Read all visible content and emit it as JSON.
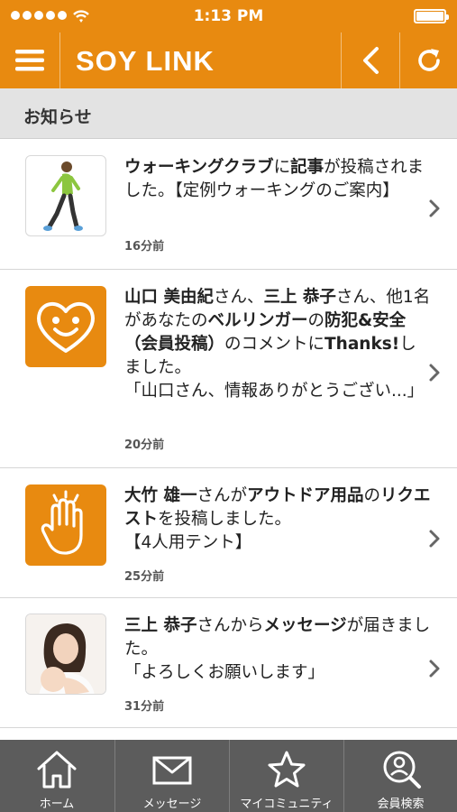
{
  "status_bar": {
    "time": "1:13 PM"
  },
  "header": {
    "logo": "SOY LINK"
  },
  "section": {
    "title": "お知らせ"
  },
  "notifications": [
    {
      "thumbnail": "walking-person-photo",
      "parts": [
        {
          "t": "ウォーキングクラブ",
          "b": true
        },
        {
          "t": "に",
          "b": false
        },
        {
          "t": "記事",
          "b": true
        },
        {
          "t": "が投稿されました。【定例ウォーキングのご案内】",
          "b": false
        }
      ],
      "time": "16分前"
    },
    {
      "thumbnail": "heart-face-icon",
      "parts": [
        {
          "t": "山口 美由紀",
          "b": true
        },
        {
          "t": "さん、",
          "b": false
        },
        {
          "t": "三上 恭子",
          "b": true
        },
        {
          "t": "さん、他1名があなたの",
          "b": false
        },
        {
          "t": "ベルリンガー",
          "b": true
        },
        {
          "t": "の",
          "b": false
        },
        {
          "t": "防犯&安全（会員投稿）",
          "b": true
        },
        {
          "t": "のコメントに",
          "b": false
        },
        {
          "t": "Thanks!",
          "b": true
        },
        {
          "t": "しました。\n「山口さん、情報ありがとうござい...」",
          "b": false
        }
      ],
      "time": "20分前"
    },
    {
      "thumbnail": "raised-hand-icon",
      "parts": [
        {
          "t": "大竹 雄一",
          "b": true
        },
        {
          "t": "さんが",
          "b": false
        },
        {
          "t": "アウトドア用品",
          "b": true
        },
        {
          "t": "の",
          "b": false
        },
        {
          "t": "リクエスト",
          "b": true
        },
        {
          "t": "を投稿しました。\n【4人用テント】",
          "b": false
        }
      ],
      "time": "25分前"
    },
    {
      "thumbnail": "mother-baby-photo",
      "parts": [
        {
          "t": "三上 恭子",
          "b": true
        },
        {
          "t": "さんから",
          "b": false
        },
        {
          "t": "メッセージ",
          "b": true
        },
        {
          "t": "が届きました。\n「よろしくお願いします」",
          "b": false
        }
      ],
      "time": "31分前"
    }
  ],
  "tabs": [
    {
      "label": "ホーム",
      "icon": "home-icon"
    },
    {
      "label": "メッセージ",
      "icon": "envelope-icon"
    },
    {
      "label": "マイコミュニティ",
      "icon": "star-icon"
    },
    {
      "label": "会員検索",
      "icon": "search-person-icon"
    }
  ],
  "colors": {
    "accent": "#e88a10",
    "tabbar": "#5c5c5c",
    "section_bg": "#e3e3e3"
  }
}
